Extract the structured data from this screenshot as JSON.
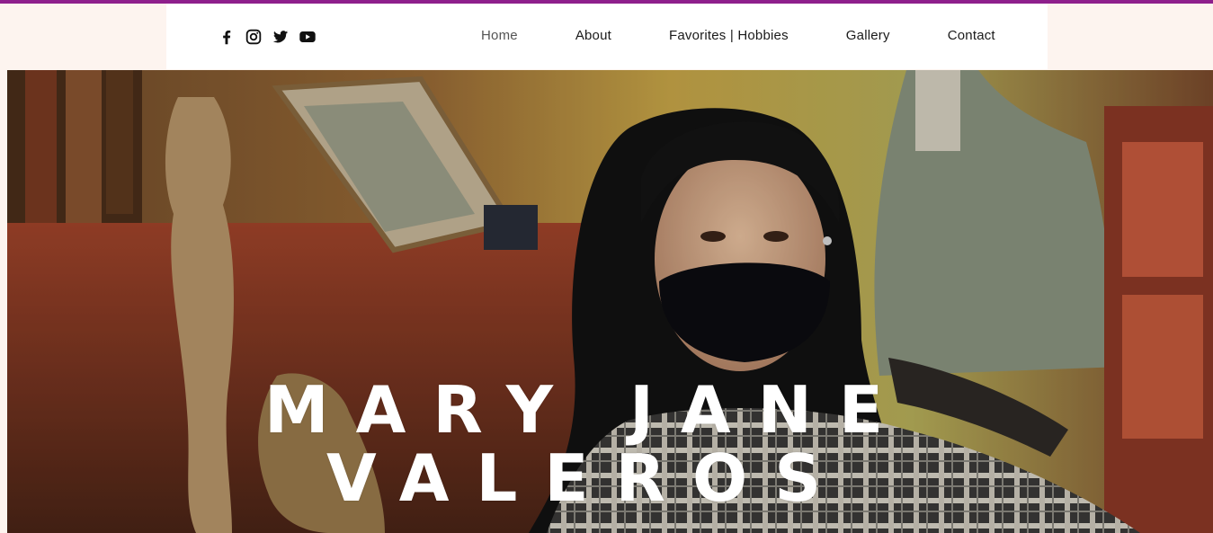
{
  "colors": {
    "accent": "#8e1f8c",
    "header_bg": "#ffffff",
    "page_bg": "#fdf4ef",
    "nav_text": "#1a1a1a",
    "title_text": "#ffffff"
  },
  "social": [
    {
      "name": "facebook",
      "icon": "facebook-icon"
    },
    {
      "name": "instagram",
      "icon": "instagram-icon"
    },
    {
      "name": "twitter",
      "icon": "twitter-icon"
    },
    {
      "name": "youtube",
      "icon": "youtube-icon"
    }
  ],
  "nav": {
    "home": "Home",
    "about": "About",
    "favorites": "Favorites | Hobbies",
    "gallery": "Gallery",
    "contact": "Contact",
    "active": "Home"
  },
  "hero": {
    "title_line1": "MARY JANE",
    "title_line2": "VALEROS"
  }
}
